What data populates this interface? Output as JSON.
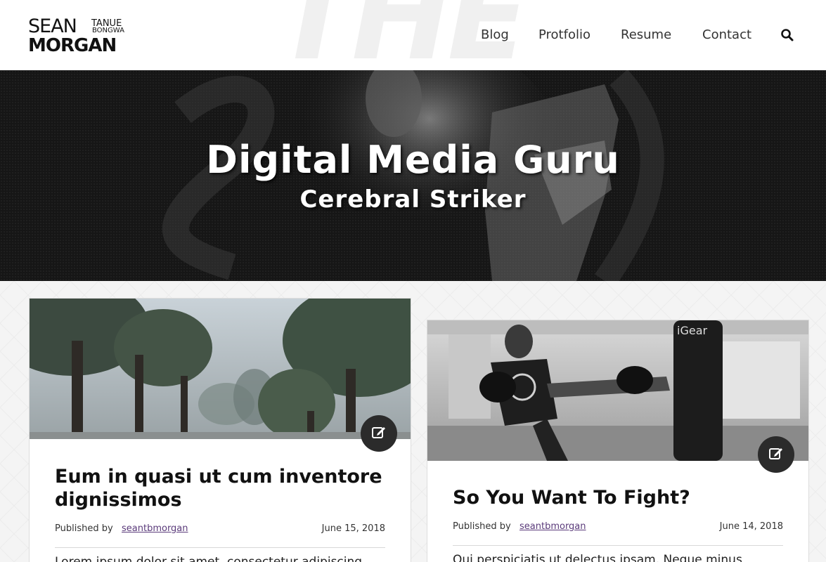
{
  "header": {
    "watermark": "THE",
    "logo": {
      "first": "SEAN",
      "middle_top": "TANUE",
      "middle_bottom": "BONGWA",
      "last": "MORGAN"
    },
    "nav": [
      {
        "label": "Blog"
      },
      {
        "label": "Protfolio"
      },
      {
        "label": "Resume"
      },
      {
        "label": "Contact"
      }
    ],
    "search_icon": "search-icon"
  },
  "hero": {
    "title": "Digital Media Guru",
    "subtitle": "Cerebral Striker"
  },
  "posts": [
    {
      "title": "Eum in quasi ut cum inventore dignissimos",
      "published_label": "Published by",
      "author": "seantbmorgan",
      "date": "June 15, 2018",
      "excerpt": "Lorem ipsum dolor sit amet, consectetur adipiscing",
      "edit_icon": "edit-icon"
    },
    {
      "title": "So You Want To Fight?",
      "published_label": "Published by",
      "author": "seantbmorgan",
      "date": "June 14, 2018",
      "excerpt": "Qui perspiciatis ut delectus ipsam. Neque minus",
      "edit_icon": "edit-icon"
    }
  ],
  "colors": {
    "header_bg": "#ffffff",
    "hero_bg": "#1b1b1b",
    "edit_button": "#2b2b2b",
    "author_link": "#5a3a7a",
    "page_bg": "#f4f4f4"
  }
}
